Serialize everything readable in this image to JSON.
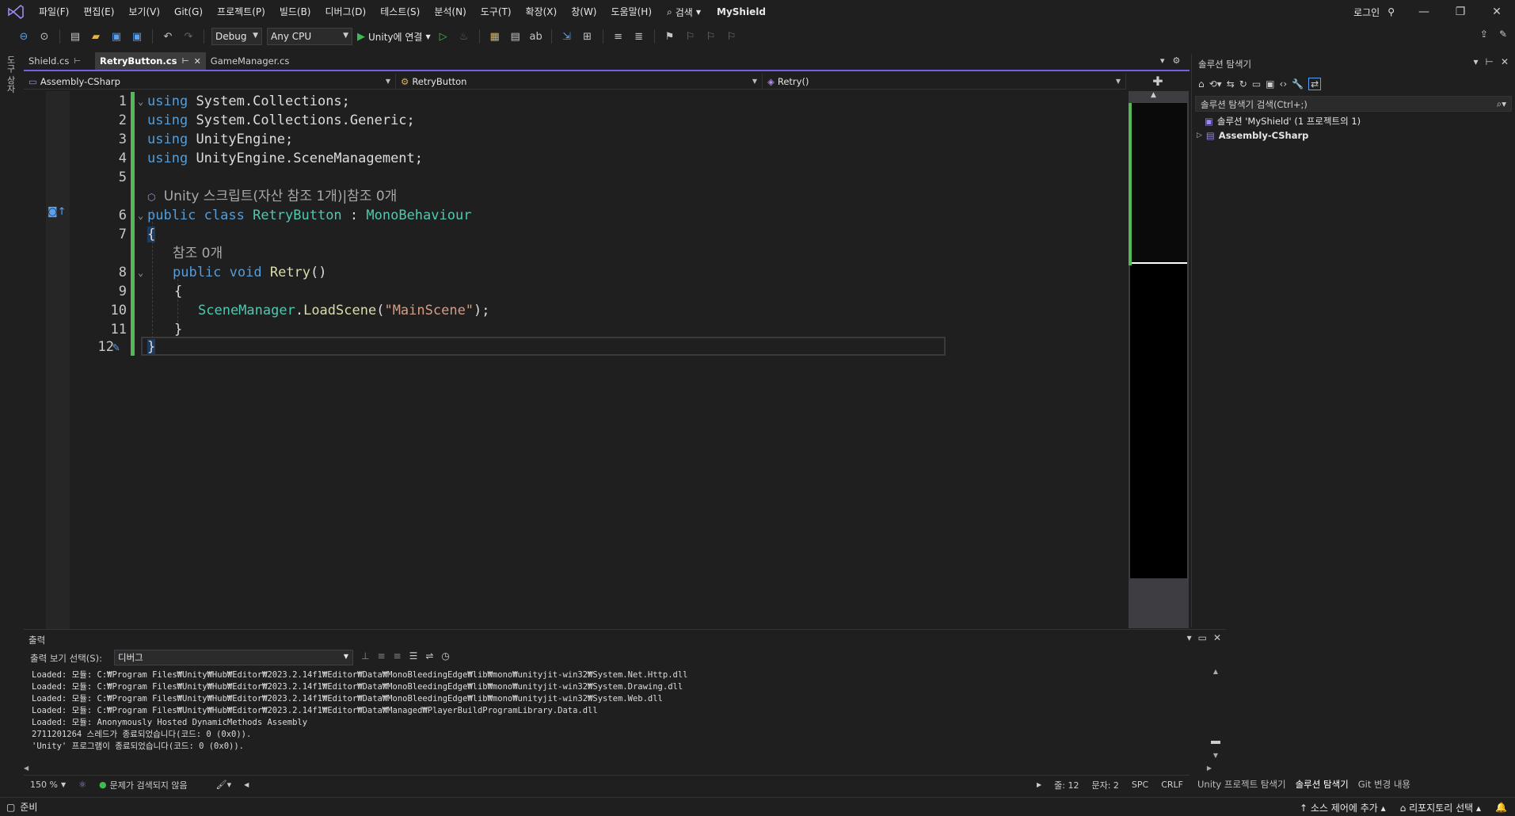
{
  "menu": {
    "items": [
      "파일(F)",
      "편집(E)",
      "보기(V)",
      "Git(G)",
      "프로젝트(P)",
      "빌드(B)",
      "디버그(D)",
      "테스트(S)",
      "분석(N)",
      "도구(T)",
      "확장(X)",
      "창(W)",
      "도움말(H)"
    ],
    "search_label": "검색",
    "solution_name": "MyShield",
    "login": "로그인"
  },
  "toolbar": {
    "config": "Debug",
    "platform": "Any CPU",
    "run_label": "Unity에 연결"
  },
  "left_strip_label": "도구 상자",
  "tabs": [
    {
      "label": "Shield.cs",
      "active": false,
      "pinned": true
    },
    {
      "label": "RetryButton.cs",
      "active": true,
      "pinned": true
    },
    {
      "label": "GameManager.cs",
      "active": false,
      "pinned": false
    }
  ],
  "navbar": {
    "project": "Assembly-CSharp",
    "type": "RetryButton",
    "member": "Retry()"
  },
  "code": {
    "line_numbers": [
      "1",
      "2",
      "3",
      "4",
      "5",
      "6",
      "7",
      "8",
      "9",
      "10",
      "11",
      "12"
    ],
    "using1_kw": "using",
    "using1_ns": "System.Collections;",
    "using2_kw": "using",
    "using2_ns": "System.Collections.Generic;",
    "using3_kw": "using",
    "using3_ns": "UnityEngine;",
    "using4_kw": "using",
    "using4_ns": "UnityEngine.SceneManagement;",
    "codelens_class": "Unity 스크립트(자산 참조 1개)|참조 0개",
    "class_mods": "public class",
    "class_name": "RetryButton",
    "class_sep": " : ",
    "class_base": "MonoBehaviour",
    "open_brace": "{",
    "codelens_method": "참조 0개",
    "method_mods": "public void",
    "method_name": "Retry",
    "method_parens": "()",
    "inner_open": "{",
    "call_type": "SceneManager",
    "call_dot": ".",
    "call_method": "LoadScene",
    "call_open": "(",
    "call_arg": "\"MainScene\"",
    "call_close": ");",
    "inner_close": "}",
    "close_brace": "}"
  },
  "solution_explorer": {
    "title": "솔루션 탐색기",
    "search_placeholder": "솔루션 탐색기 검색(Ctrl+;)",
    "solution_node": "솔루션 'MyShield' (1 프로젝트의 1)",
    "project_node": "Assembly-CSharp"
  },
  "output": {
    "title": "출력",
    "show_label": "출력 보기 선택(S):",
    "source": "디버그",
    "lines": [
      "Loaded: 모듈: C:₩Program Files₩Unity₩Hub₩Editor₩2023.2.14f1₩Editor₩Data₩MonoBleedingEdge₩lib₩mono₩unityjit-win32₩System.Net.Http.dll",
      "Loaded: 모듈: C:₩Program Files₩Unity₩Hub₩Editor₩2023.2.14f1₩Editor₩Data₩MonoBleedingEdge₩lib₩mono₩unityjit-win32₩System.Drawing.dll",
      "Loaded: 모듈: C:₩Program Files₩Unity₩Hub₩Editor₩2023.2.14f1₩Editor₩Data₩MonoBleedingEdge₩lib₩mono₩unityjit-win32₩System.Web.dll",
      "Loaded: 모듈: C:₩Program Files₩Unity₩Hub₩Editor₩2023.2.14f1₩Editor₩Data₩Managed₩PlayerBuildProgramLibrary.Data.dll",
      "Loaded: 모듈: Anonymously Hosted DynamicMethods Assembly",
      "2711201264 스레드가 종료되었습니다(코드: 0 (0x0)).",
      "'Unity' 프로그램이 종료되었습니다(코드: 0 (0x0))."
    ]
  },
  "editor_status": {
    "zoom": "150 %",
    "issues": "문제가 검색되지 않음",
    "line": "줄: 12",
    "col": "문자: 2",
    "ws": "SPC",
    "eol": "CRLF"
  },
  "bottom_tabs": [
    "Unity 프로젝트 탐색기",
    "솔루션 탐색기",
    "Git 변경 내용"
  ],
  "status": {
    "ready": "준비",
    "source_control": "소스 제어에 추가",
    "repo": "리포지토리 선택"
  },
  "colors": {
    "accent": "#7160e8",
    "change_bar": "#57b65a"
  }
}
